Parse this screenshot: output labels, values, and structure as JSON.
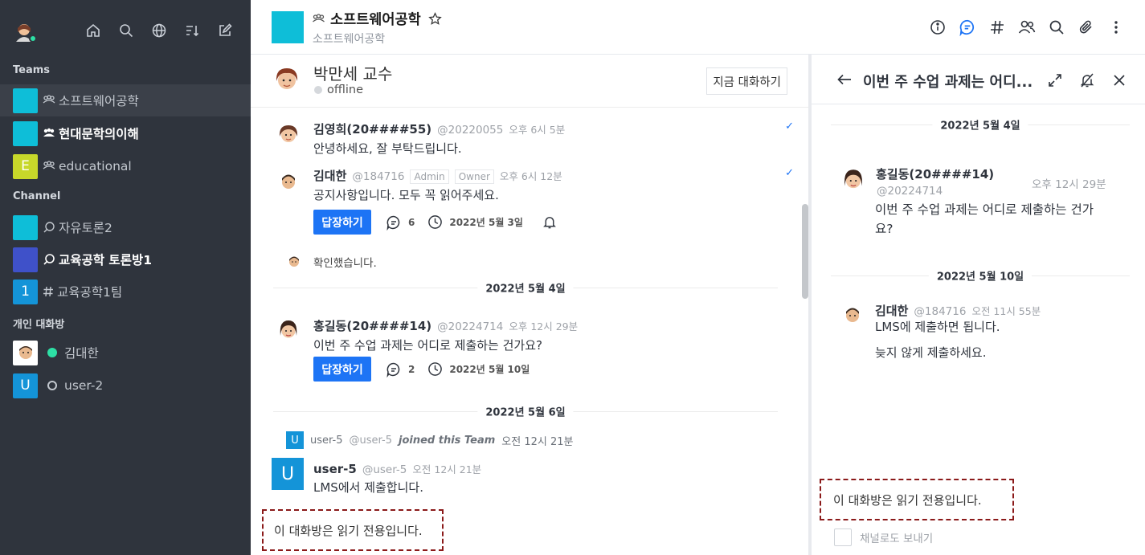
{
  "sidebar": {
    "sections": {
      "teams": "Teams",
      "channel": "Channel",
      "dm": "개인 대화방"
    },
    "teams": [
      {
        "label": "소프트웨어공학",
        "avatar": "",
        "color": "#0ebed8",
        "active": true
      },
      {
        "label": "현대문학의이해",
        "avatar": "",
        "color": "#0ebed8",
        "bold": true
      },
      {
        "label": "educational",
        "avatar": "E",
        "color": "#c8d82a"
      }
    ],
    "channels": [
      {
        "label": "자유토론2",
        "avatar": "",
        "color": "#0ebed8"
      },
      {
        "label": "교육공학 토론방1",
        "avatar": "",
        "color": "#3f51c9",
        "bold": true
      },
      {
        "label": "교육공학1팀",
        "avatar": "1",
        "color": "#1494d8"
      }
    ],
    "dms": [
      {
        "label": "김대한",
        "status": "online"
      },
      {
        "label": "user-2",
        "avatar": "U",
        "status": "offline"
      }
    ]
  },
  "header": {
    "title": "소프트웨어공학",
    "subtitle": "소프트웨어공학"
  },
  "dm_header": {
    "name": "박만세 교수",
    "status": "offline",
    "talk_button": "지금 대화하기"
  },
  "messages": {
    "m1": {
      "name": "김영희(20####55)",
      "handle": "@20220055",
      "time": "오후 6시 5분",
      "body": "안녕하세요, 잘 부탁드립니다."
    },
    "m2": {
      "name": "김대한",
      "handle": "@184716",
      "role1": "Admin",
      "role2": "Owner",
      "time": "오후 6시 12분",
      "body": "공지사항입니다. 모두 꼭 읽어주세요.",
      "reply": "답장하기",
      "replies": "6",
      "date": "2022년 5월 3일"
    },
    "m3": {
      "body": "확인했습니다."
    },
    "div1": "2022년 5월 4일",
    "m4": {
      "name": "홍길동(20####14)",
      "handle": "@20224714",
      "time": "오후 12시 29분",
      "body": "이번 주 수업 과제는 어디로 제출하는 건가요?",
      "reply": "답장하기",
      "replies": "2",
      "date": "2022년 5월 10일"
    },
    "div2": "2022년 5월 6일",
    "sys": {
      "avatar": "U",
      "name": "user-5",
      "handle": "@user-5",
      "action": "joined this Team",
      "time": "오전 12시 21분"
    },
    "m5": {
      "avatar": "U",
      "name": "user-5",
      "handle": "@user-5",
      "time": "오전 12시 21분",
      "body": "LMS에서 제출합니다."
    }
  },
  "readonly_main": "이 대화방은 읽기 전용입니다.",
  "thread": {
    "title": "이번 주 수업 과제는 어디...",
    "div1": "2022년 5월 4일",
    "t1": {
      "name": "홍길동(20####14)",
      "time": "오후 12시 29분",
      "handle": "@20224714",
      "body": "이번 주 수업 과제는 어디로 제출하는 건가요?"
    },
    "div2": "2022년 5월 10일",
    "t2": {
      "name": "김대한",
      "handle": "@184716",
      "time": "오전 11시 55분",
      "body1": "LMS에 제출하면 됩니다.",
      "body2": "늦지 않게 제출하세요."
    },
    "readonly": "이 대화방은 읽기 전용입니다.",
    "also_send": "채널로도 보내기"
  },
  "colors": {
    "sidebar_bg": "#2f343d",
    "primary": "#1d74f5",
    "team_cyan": "#0ebed8",
    "online": "#2de0a5"
  }
}
